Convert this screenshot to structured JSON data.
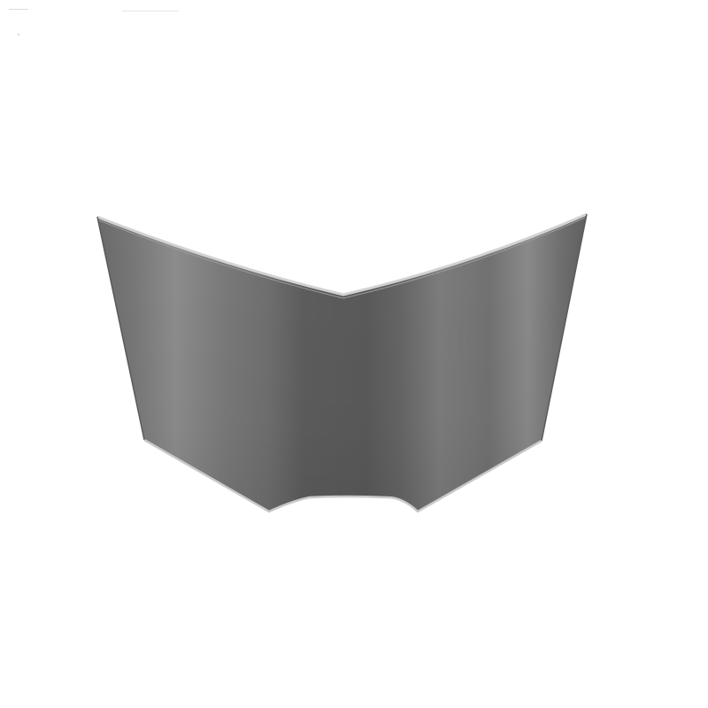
{
  "scene": {
    "object": "curved-sheet-metal-panel",
    "colors": {
      "background": "#ffffff",
      "panel_dark": "#5e5e5e",
      "panel_mid": "#737373",
      "panel_light": "#8f8f8f",
      "edge_highlight": "#cfcfcf"
    }
  }
}
